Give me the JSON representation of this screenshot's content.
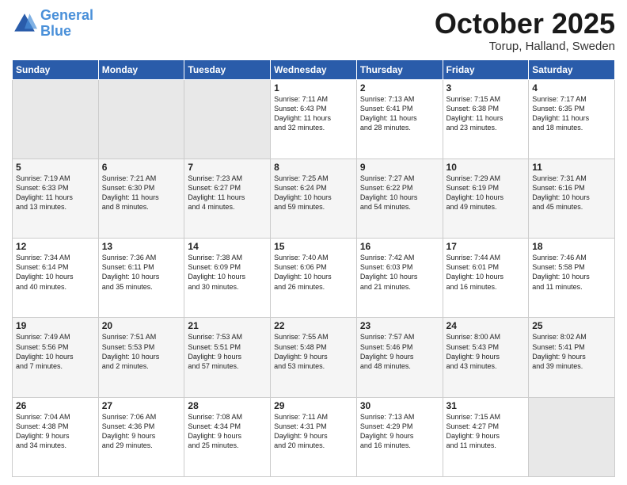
{
  "logo": {
    "line1": "General",
    "line2": "Blue"
  },
  "header": {
    "month": "October 2025",
    "location": "Torup, Halland, Sweden"
  },
  "weekdays": [
    "Sunday",
    "Monday",
    "Tuesday",
    "Wednesday",
    "Thursday",
    "Friday",
    "Saturday"
  ],
  "weeks": [
    [
      {
        "day": "",
        "info": ""
      },
      {
        "day": "",
        "info": ""
      },
      {
        "day": "",
        "info": ""
      },
      {
        "day": "1",
        "info": "Sunrise: 7:11 AM\nSunset: 6:43 PM\nDaylight: 11 hours\nand 32 minutes."
      },
      {
        "day": "2",
        "info": "Sunrise: 7:13 AM\nSunset: 6:41 PM\nDaylight: 11 hours\nand 28 minutes."
      },
      {
        "day": "3",
        "info": "Sunrise: 7:15 AM\nSunset: 6:38 PM\nDaylight: 11 hours\nand 23 minutes."
      },
      {
        "day": "4",
        "info": "Sunrise: 7:17 AM\nSunset: 6:35 PM\nDaylight: 11 hours\nand 18 minutes."
      }
    ],
    [
      {
        "day": "5",
        "info": "Sunrise: 7:19 AM\nSunset: 6:33 PM\nDaylight: 11 hours\nand 13 minutes."
      },
      {
        "day": "6",
        "info": "Sunrise: 7:21 AM\nSunset: 6:30 PM\nDaylight: 11 hours\nand 8 minutes."
      },
      {
        "day": "7",
        "info": "Sunrise: 7:23 AM\nSunset: 6:27 PM\nDaylight: 11 hours\nand 4 minutes."
      },
      {
        "day": "8",
        "info": "Sunrise: 7:25 AM\nSunset: 6:24 PM\nDaylight: 10 hours\nand 59 minutes."
      },
      {
        "day": "9",
        "info": "Sunrise: 7:27 AM\nSunset: 6:22 PM\nDaylight: 10 hours\nand 54 minutes."
      },
      {
        "day": "10",
        "info": "Sunrise: 7:29 AM\nSunset: 6:19 PM\nDaylight: 10 hours\nand 49 minutes."
      },
      {
        "day": "11",
        "info": "Sunrise: 7:31 AM\nSunset: 6:16 PM\nDaylight: 10 hours\nand 45 minutes."
      }
    ],
    [
      {
        "day": "12",
        "info": "Sunrise: 7:34 AM\nSunset: 6:14 PM\nDaylight: 10 hours\nand 40 minutes."
      },
      {
        "day": "13",
        "info": "Sunrise: 7:36 AM\nSunset: 6:11 PM\nDaylight: 10 hours\nand 35 minutes."
      },
      {
        "day": "14",
        "info": "Sunrise: 7:38 AM\nSunset: 6:09 PM\nDaylight: 10 hours\nand 30 minutes."
      },
      {
        "day": "15",
        "info": "Sunrise: 7:40 AM\nSunset: 6:06 PM\nDaylight: 10 hours\nand 26 minutes."
      },
      {
        "day": "16",
        "info": "Sunrise: 7:42 AM\nSunset: 6:03 PM\nDaylight: 10 hours\nand 21 minutes."
      },
      {
        "day": "17",
        "info": "Sunrise: 7:44 AM\nSunset: 6:01 PM\nDaylight: 10 hours\nand 16 minutes."
      },
      {
        "day": "18",
        "info": "Sunrise: 7:46 AM\nSunset: 5:58 PM\nDaylight: 10 hours\nand 11 minutes."
      }
    ],
    [
      {
        "day": "19",
        "info": "Sunrise: 7:49 AM\nSunset: 5:56 PM\nDaylight: 10 hours\nand 7 minutes."
      },
      {
        "day": "20",
        "info": "Sunrise: 7:51 AM\nSunset: 5:53 PM\nDaylight: 10 hours\nand 2 minutes."
      },
      {
        "day": "21",
        "info": "Sunrise: 7:53 AM\nSunset: 5:51 PM\nDaylight: 9 hours\nand 57 minutes."
      },
      {
        "day": "22",
        "info": "Sunrise: 7:55 AM\nSunset: 5:48 PM\nDaylight: 9 hours\nand 53 minutes."
      },
      {
        "day": "23",
        "info": "Sunrise: 7:57 AM\nSunset: 5:46 PM\nDaylight: 9 hours\nand 48 minutes."
      },
      {
        "day": "24",
        "info": "Sunrise: 8:00 AM\nSunset: 5:43 PM\nDaylight: 9 hours\nand 43 minutes."
      },
      {
        "day": "25",
        "info": "Sunrise: 8:02 AM\nSunset: 5:41 PM\nDaylight: 9 hours\nand 39 minutes."
      }
    ],
    [
      {
        "day": "26",
        "info": "Sunrise: 7:04 AM\nSunset: 4:38 PM\nDaylight: 9 hours\nand 34 minutes."
      },
      {
        "day": "27",
        "info": "Sunrise: 7:06 AM\nSunset: 4:36 PM\nDaylight: 9 hours\nand 29 minutes."
      },
      {
        "day": "28",
        "info": "Sunrise: 7:08 AM\nSunset: 4:34 PM\nDaylight: 9 hours\nand 25 minutes."
      },
      {
        "day": "29",
        "info": "Sunrise: 7:11 AM\nSunset: 4:31 PM\nDaylight: 9 hours\nand 20 minutes."
      },
      {
        "day": "30",
        "info": "Sunrise: 7:13 AM\nSunset: 4:29 PM\nDaylight: 9 hours\nand 16 minutes."
      },
      {
        "day": "31",
        "info": "Sunrise: 7:15 AM\nSunset: 4:27 PM\nDaylight: 9 hours\nand 11 minutes."
      },
      {
        "day": "",
        "info": ""
      }
    ]
  ]
}
